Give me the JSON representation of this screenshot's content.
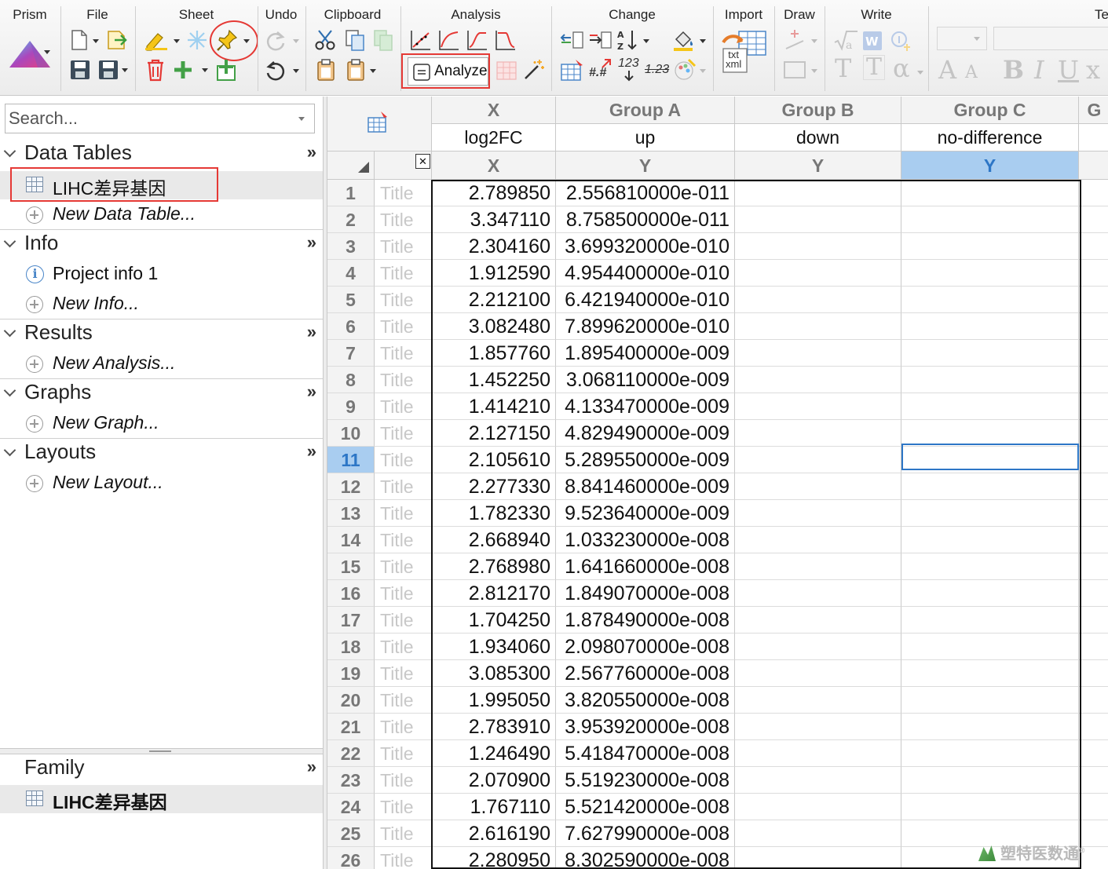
{
  "ribbon": {
    "groups": {
      "prism": "Prism",
      "file": "File",
      "sheet": "Sheet",
      "undo": "Undo",
      "clipboard": "Clipboard",
      "analysis": "Analysis",
      "change": "Change",
      "import": "Import",
      "draw": "Draw",
      "write": "Write",
      "text": "Te"
    },
    "analyze_label": "Analyze",
    "change_num_a": "123",
    "change_num_b": "1.23",
    "change_hash": "#.#",
    "import_badge": "txt\nxml",
    "write_letters": [
      "T",
      "T",
      "α",
      "A",
      "A",
      "B",
      "I",
      "U",
      "x"
    ],
    "accent_red": "#e53935"
  },
  "navigator": {
    "search_placeholder": "Search...",
    "sections": [
      {
        "title": "Data Tables",
        "items": [
          {
            "label": "LIHC差异基因",
            "icon": "table-icon",
            "selected": true
          },
          {
            "label": "New Data Table...",
            "icon": "plus-circle-icon",
            "italic": true
          }
        ]
      },
      {
        "title": "Info",
        "items": [
          {
            "label": "Project info 1",
            "icon": "info-icon"
          },
          {
            "label": "New Info...",
            "icon": "plus-circle-icon",
            "italic": true
          }
        ]
      },
      {
        "title": "Results",
        "items": [
          {
            "label": "New Analysis...",
            "icon": "plus-circle-icon",
            "italic": true
          }
        ]
      },
      {
        "title": "Graphs",
        "items": [
          {
            "label": "New Graph...",
            "icon": "plus-circle-icon",
            "italic": true
          }
        ]
      },
      {
        "title": "Layouts",
        "items": [
          {
            "label": "New Layout...",
            "icon": "plus-circle-icon",
            "italic": true
          }
        ]
      }
    ],
    "expand_glyph": "»",
    "family": {
      "title": "Family",
      "item": "LIHC差异基因"
    }
  },
  "sheet": {
    "columns": [
      {
        "title": "X",
        "subtitle": "log2FC",
        "type": "X"
      },
      {
        "title": "Group A",
        "subtitle": "up",
        "type": "Y"
      },
      {
        "title": "Group B",
        "subtitle": "down",
        "type": "Y"
      },
      {
        "title": "Group C",
        "subtitle": "no-difference",
        "type": "Y"
      },
      {
        "title": "G",
        "subtitle": "",
        "type": ""
      }
    ],
    "close_glyph": "✕",
    "row_title_placeholder": "Title",
    "selected_row": 11,
    "selected_column": 3,
    "rows": [
      {
        "n": "1",
        "x": "2.789850",
        "a": "2.556810000e-011"
      },
      {
        "n": "2",
        "x": "3.347110",
        "a": "8.758500000e-011"
      },
      {
        "n": "3",
        "x": "2.304160",
        "a": "3.699320000e-010"
      },
      {
        "n": "4",
        "x": "1.912590",
        "a": "4.954400000e-010"
      },
      {
        "n": "5",
        "x": "2.212100",
        "a": "6.421940000e-010"
      },
      {
        "n": "6",
        "x": "3.082480",
        "a": "7.899620000e-010"
      },
      {
        "n": "7",
        "x": "1.857760",
        "a": "1.895400000e-009"
      },
      {
        "n": "8",
        "x": "1.452250",
        "a": "3.068110000e-009"
      },
      {
        "n": "9",
        "x": "1.414210",
        "a": "4.133470000e-009"
      },
      {
        "n": "10",
        "x": "2.127150",
        "a": "4.829490000e-009"
      },
      {
        "n": "11",
        "x": "2.105610",
        "a": "5.289550000e-009"
      },
      {
        "n": "12",
        "x": "2.277330",
        "a": "8.841460000e-009"
      },
      {
        "n": "13",
        "x": "1.782330",
        "a": "9.523640000e-009"
      },
      {
        "n": "14",
        "x": "2.668940",
        "a": "1.033230000e-008"
      },
      {
        "n": "15",
        "x": "2.768980",
        "a": "1.641660000e-008"
      },
      {
        "n": "16",
        "x": "2.812170",
        "a": "1.849070000e-008"
      },
      {
        "n": "17",
        "x": "1.704250",
        "a": "1.878490000e-008"
      },
      {
        "n": "18",
        "x": "1.934060",
        "a": "2.098070000e-008"
      },
      {
        "n": "19",
        "x": "3.085300",
        "a": "2.567760000e-008"
      },
      {
        "n": "20",
        "x": "1.995050",
        "a": "3.820550000e-008"
      },
      {
        "n": "21",
        "x": "2.783910",
        "a": "3.953920000e-008"
      },
      {
        "n": "22",
        "x": "1.246490",
        "a": "5.418470000e-008"
      },
      {
        "n": "23",
        "x": "2.070900",
        "a": "5.519230000e-008"
      },
      {
        "n": "24",
        "x": "1.767110",
        "a": "5.521420000e-008"
      },
      {
        "n": "25",
        "x": "2.616190",
        "a": "7.627990000e-008"
      },
      {
        "n": "26",
        "x": "2.280950",
        "a": "8.302590000e-008"
      }
    ]
  },
  "watermark": {
    "text": "塑特医数通",
    "mark": "®"
  }
}
